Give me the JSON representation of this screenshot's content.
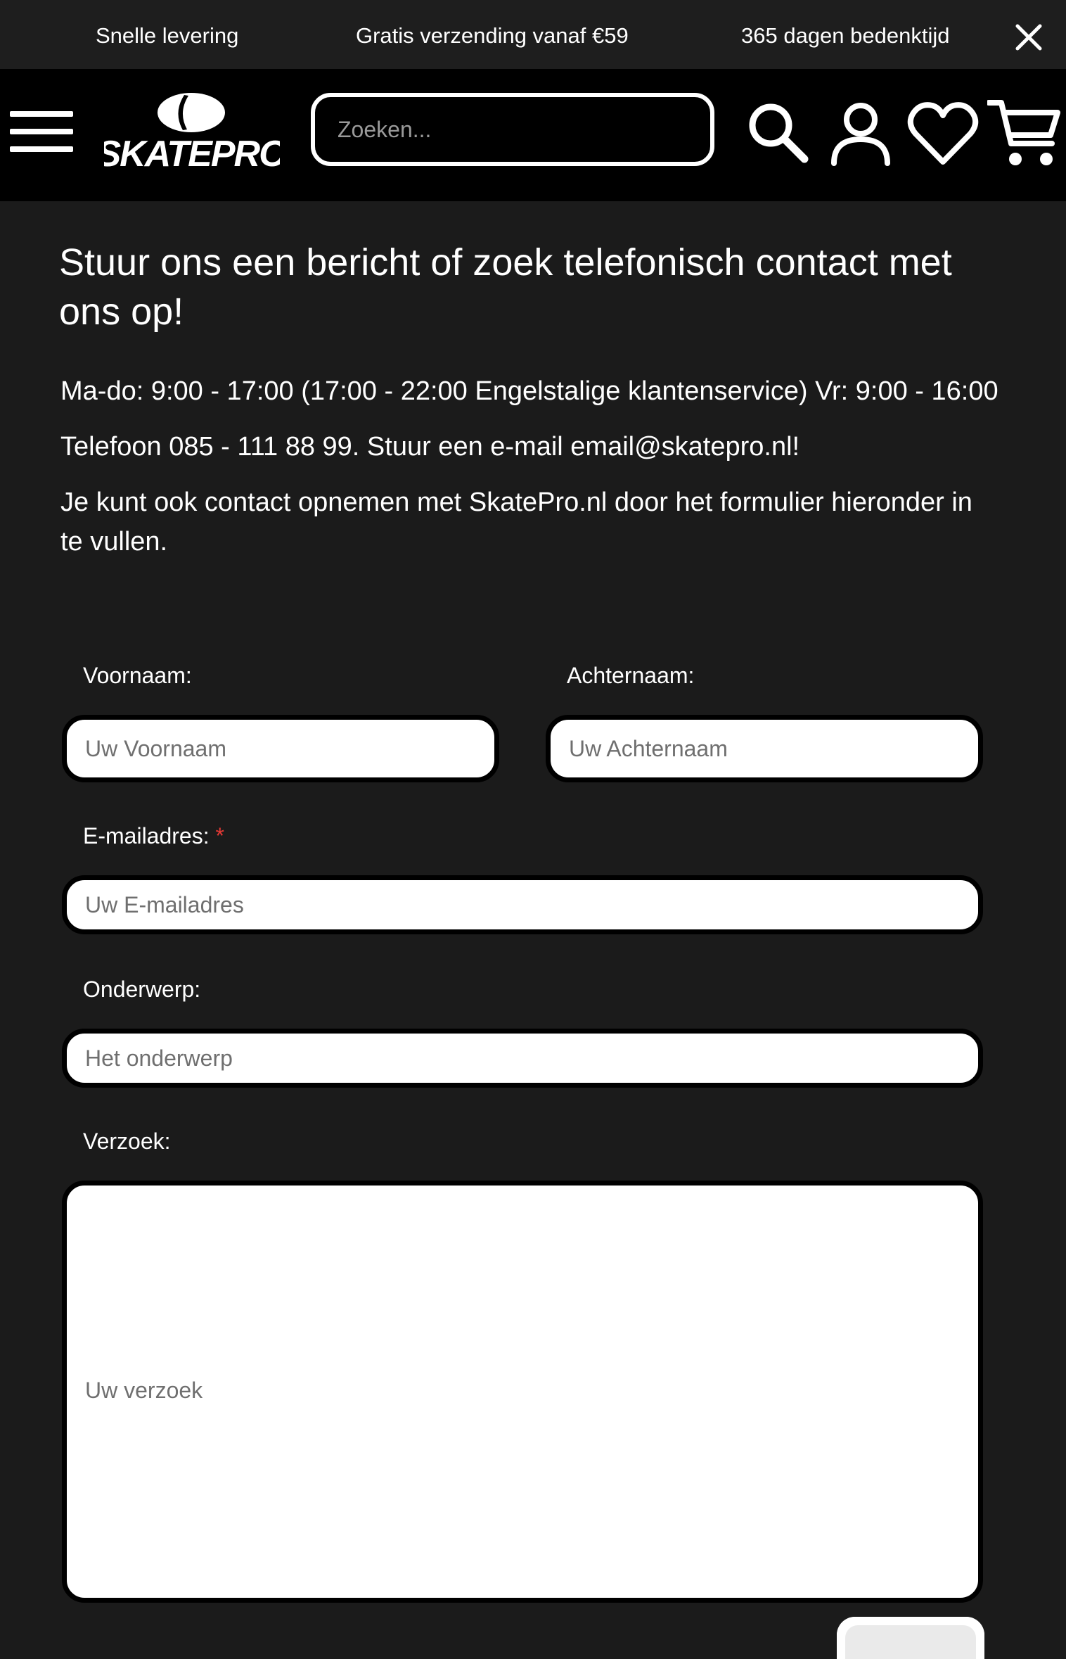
{
  "topbar": {
    "promos": [
      "Snelle levering",
      "Gratis verzending vanaf €59",
      "365 dagen bedenktijd"
    ],
    "close_icon": "close-icon"
  },
  "header": {
    "logo_text": "SKATEPRO",
    "search_placeholder": "Zoeken...",
    "icons": [
      "menu-icon",
      "search-icon",
      "user-icon",
      "heart-icon",
      "cart-icon"
    ]
  },
  "content": {
    "title": "Stuur ons een bericht of zoek telefonisch contact met ons op!",
    "hours": "Ma-do: 9:00 - 17:00 (17:00 - 22:00 Engelstalige klantenservice) Vr: 9:00 - 16:00",
    "phone": "Telefoon 085 - 111 88 99. Stuur een e-mail email@skatepro.nl!",
    "intro": "Je kunt ook contact opnemen met SkatePro.nl door het formulier hieronder in te vullen."
  },
  "form": {
    "firstname_label": "Voornaam:",
    "firstname_placeholder": "Uw Voornaam",
    "lastname_label": "Achternaam:",
    "lastname_placeholder": "Uw Achternaam",
    "email_label": "E-mailadres:",
    "email_required": "*",
    "email_placeholder": "Uw E-mailadres",
    "subject_label": "Onderwerp:",
    "subject_placeholder": "Het onderwerp",
    "request_label": "Verzoek:",
    "request_placeholder": "Uw verzoek"
  },
  "colors": {
    "background": "#1b1b1b",
    "header": "#000000",
    "required": "#e53935"
  }
}
